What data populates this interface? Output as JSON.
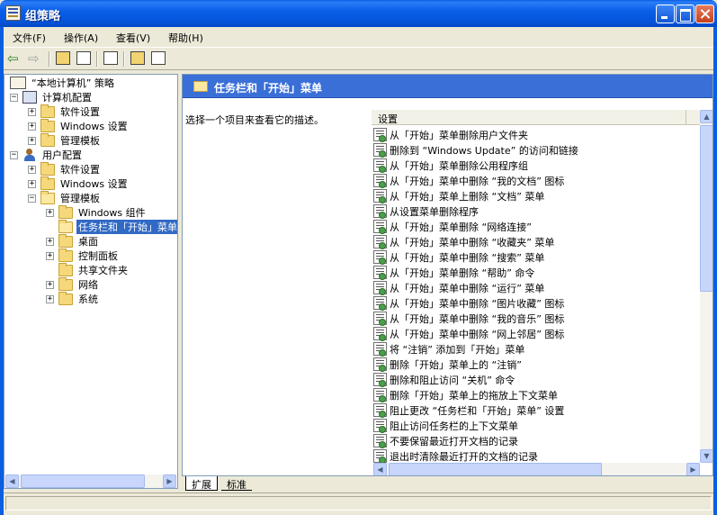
{
  "window": {
    "title": "组策略"
  },
  "menubar": {
    "items": [
      "文件(F)",
      "操作(A)",
      "查看(V)",
      "帮助(H)"
    ]
  },
  "toolbar": {
    "icons": [
      "back-arrow",
      "forward-arrow",
      "up-folder",
      "show-tree",
      "export-list",
      "help-book",
      "console-view"
    ]
  },
  "tree": {
    "root": "“本地计算机” 策略",
    "computer_config": "计算机配置",
    "user_config": "用户配置",
    "software_settings": "软件设置",
    "windows_settings": "Windows 设置",
    "admin_templates": "管理模板",
    "windows_components": "Windows 组件",
    "taskbar_start": "任务栏和「开始」菜单",
    "desktop": "桌面",
    "control_panel": "控制面板",
    "shared_folders": "共享文件夹",
    "network": "网络",
    "system": "系统"
  },
  "right": {
    "header_title": "任务栏和「开始」菜单",
    "description_hint": "选择一个项目来查看它的描述。",
    "column_setting": "设置",
    "settings": [
      "从「开始」菜单删除用户文件夹",
      "删除到 “Windows Update” 的访问和链接",
      "从「开始」菜单删除公用程序组",
      "从「开始」菜单中删除 “我的文档” 图标",
      "从「开始」菜单上删除 “文档” 菜单",
      "从设置菜单删除程序",
      "从「开始」菜单删除 “网络连接”",
      "从「开始」菜单中删除 “收藏夹” 菜单",
      "从「开始」菜单中删除 “搜索” 菜单",
      "从「开始」菜单删除 “帮助” 命令",
      "从「开始」菜单中删除 “运行” 菜单",
      "从「开始」菜单中删除 “图片收藏” 图标",
      "从「开始」菜单中删除 “我的音乐” 图标",
      "从「开始」菜单中删除 “网上邻居” 图标",
      "将 “注销” 添加到「开始」菜单",
      "删除「开始」菜单上的 “注销”",
      "删除和阻止访问 “关机” 命令",
      "删除「开始」菜单上的拖放上下文菜单",
      "阻止更改 “任务栏和「开始」菜单” 设置",
      "阻止访问任务栏的上下文菜单",
      "不要保留最近打开文档的记录",
      "退出时清除最近打开的文档的记录"
    ]
  },
  "tabs": [
    "扩展",
    "标准"
  ]
}
